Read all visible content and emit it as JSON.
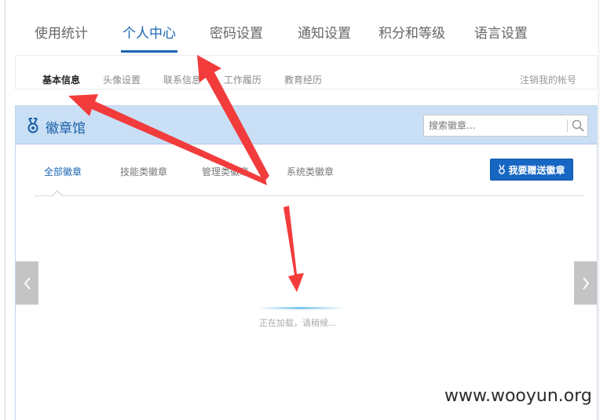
{
  "top_tabs": [
    {
      "label": "使用统计",
      "active": false
    },
    {
      "label": "个人中心",
      "active": true
    },
    {
      "label": "密码设置",
      "active": false
    },
    {
      "label": "通知设置",
      "active": false
    },
    {
      "label": "积分和等级",
      "active": false
    },
    {
      "label": "语言设置",
      "active": false
    }
  ],
  "sub_nav": {
    "items": [
      {
        "label": "基本信息",
        "active": true
      },
      {
        "label": "头像设置",
        "active": false
      },
      {
        "label": "联系信息",
        "active": false
      },
      {
        "label": "工作履历",
        "active": false
      },
      {
        "label": "教育经历",
        "active": false
      }
    ],
    "right_link": "注销我的帐号"
  },
  "badge_panel": {
    "title": "徽章馆",
    "search_placeholder": "搜索徽章...",
    "tabs": [
      {
        "label": "全部徽章",
        "active": true
      },
      {
        "label": "技能类徽章",
        "active": false
      },
      {
        "label": "管理类徽章",
        "active": false
      },
      {
        "label": "系统类徽章",
        "active": false
      }
    ],
    "gift_button_label": "我要赠送徽章",
    "loading_text": "正在加载，请稍候..."
  },
  "watermark": "www.wooyun.org",
  "colors": {
    "accent": "#1a66b3",
    "panel_header": "#c9dff5",
    "button": "#1666c3",
    "annotation_arrow": "#f23c3c"
  },
  "icons": {
    "panel": "medal-icon",
    "search": "search-icon",
    "gift": "medal-icon",
    "prev": "chevron-left-icon",
    "next": "chevron-right-icon"
  }
}
